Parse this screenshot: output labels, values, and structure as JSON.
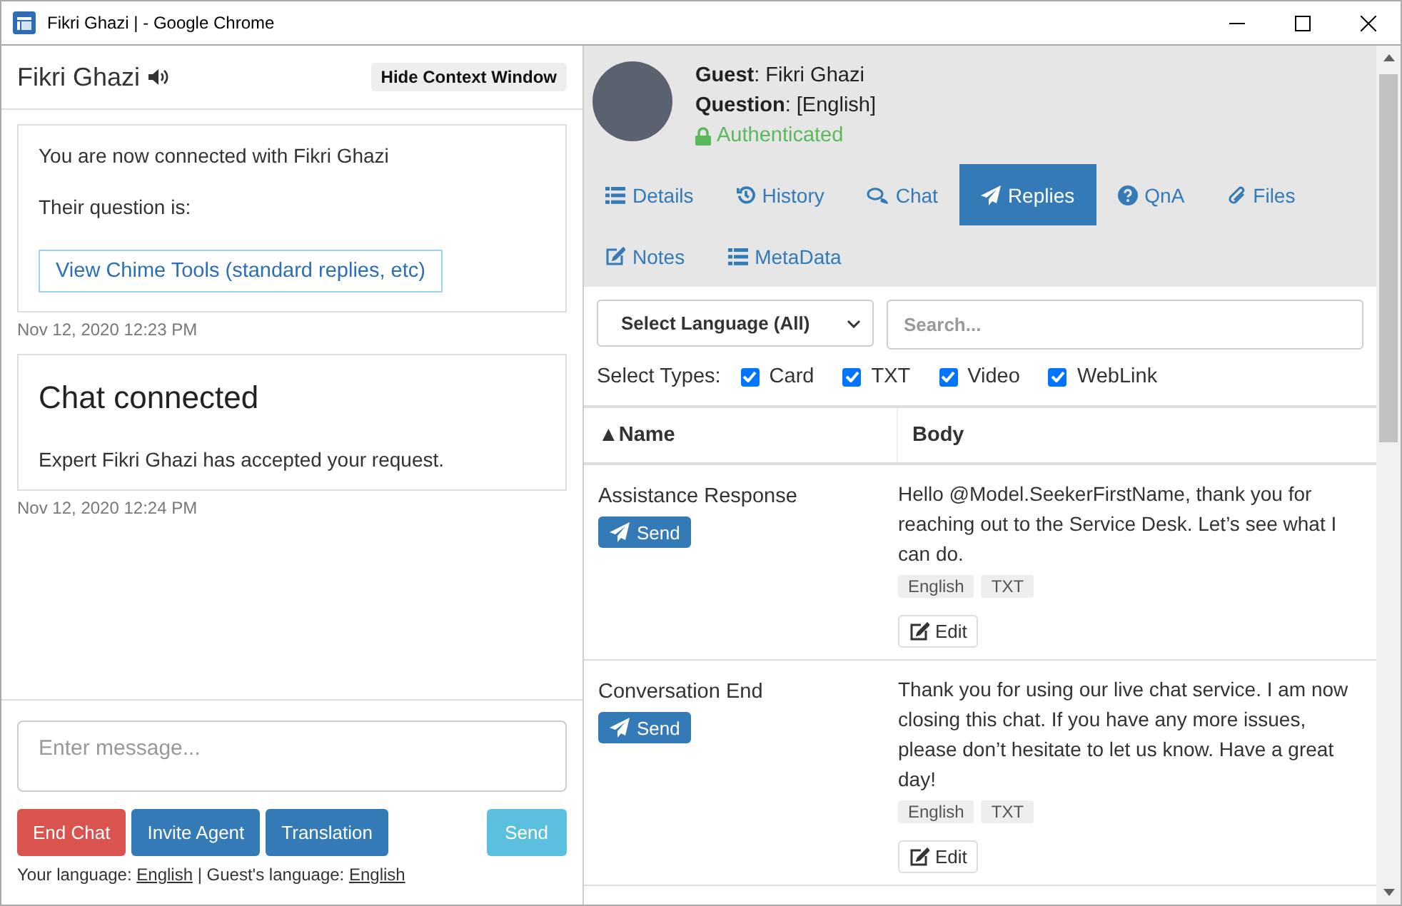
{
  "window": {
    "title": "Fikri Ghazi | - Google Chrome"
  },
  "chat": {
    "name": "Fikri Ghazi",
    "hide_button": "Hide Context Window",
    "messages": [
      {
        "kind": "intro",
        "lines": [
          "You are now connected with Fikri Ghazi",
          "Their question is:"
        ],
        "link": "View Chime Tools (standard replies, etc)",
        "time": "Nov 12, 2020 12:23 PM"
      },
      {
        "kind": "status",
        "heading": "Chat connected",
        "text": "Expert Fikri Ghazi has accepted your request.",
        "time": "Nov 12, 2020 12:24 PM"
      }
    ],
    "composer": {
      "placeholder": "Enter message...",
      "buttons": [
        {
          "label": "End Chat",
          "kind": "danger"
        },
        {
          "label": "Invite Agent",
          "kind": "primary"
        },
        {
          "label": "Translation",
          "kind": "primary"
        },
        {
          "label": "Send",
          "kind": "info"
        }
      ],
      "language": {
        "your_label": "Your language:",
        "your_value": "English",
        "separator": "|",
        "guest_label": "Guest's language:",
        "guest_value": "English"
      }
    }
  },
  "context": {
    "guest": {
      "name": "**Guest**: Fikri Ghazi",
      "question": "**Question**: [English]",
      "status": "Authenticated"
    },
    "tabs": [
      {
        "label": "Details",
        "selected": false
      },
      {
        "label": "History",
        "selected": false
      },
      {
        "label": "Chat",
        "selected": false
      },
      {
        "label": "Replies",
        "selected": true
      },
      {
        "label": "QnA",
        "selected": false
      },
      {
        "label": "Files",
        "selected": false
      },
      {
        "label": "Notes",
        "selected": false
      },
      {
        "label": "MetaData",
        "selected": false
      }
    ],
    "language_select": "Select Language (All)",
    "search": {
      "placeholder": "Search..."
    },
    "types_label": "Select Types:",
    "types": [
      {
        "label": "Card",
        "checked": true
      },
      {
        "label": "TXT",
        "checked": true
      },
      {
        "label": "Video",
        "checked": true
      },
      {
        "label": "WebLink",
        "checked": true
      }
    ],
    "table": {
      "columns": [
        "▲Name",
        "Body"
      ],
      "rows": [
        {
          "name": "Assistance Response",
          "send": "Send",
          "body": "Hello @Model.SeekerFirstName, thank you for reaching out to the Service Desk. Let’s see what I can do.",
          "tags": [
            "English",
            "TXT"
          ],
          "edit": "Edit"
        },
        {
          "name": "Conversation End",
          "send": "Send",
          "body": "Thank you for using our live chat service. I am now closing this chat. If you have any more issues, please don’t hesitate to let us know. Have a great day!",
          "tags": [
            "English",
            "TXT"
          ],
          "edit": "Edit"
        }
      ]
    }
  }
}
